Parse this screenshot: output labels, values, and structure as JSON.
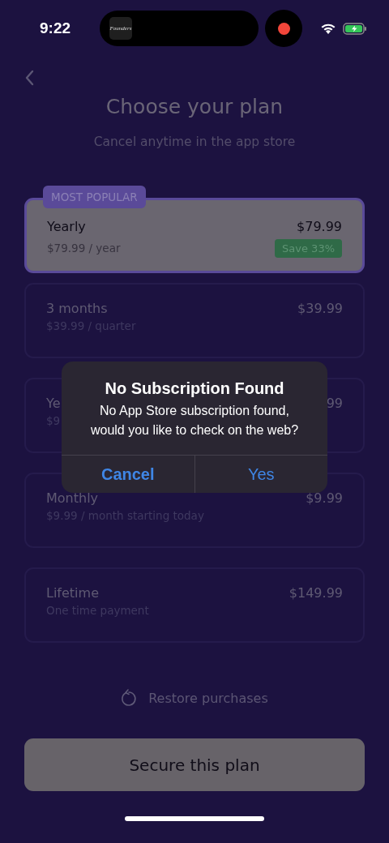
{
  "status_bar": {
    "time": "9:22",
    "island_app_label": "Founders",
    "recording": true
  },
  "header": {
    "title": "Choose your plan",
    "subtitle": "Cancel anytime in the app store"
  },
  "plans": [
    {
      "name": "Yearly",
      "detail": "$79.99 / year",
      "price": "$79.99",
      "badge": "MOST POPULAR",
      "tag": "Save 33%",
      "selected": true
    },
    {
      "name": "3 months",
      "detail": "$39.99 / quarter",
      "price": "$39.99",
      "selected": false
    },
    {
      "name": "Ye",
      "detail": "$9",
      "price": "99",
      "selected": false
    },
    {
      "name": "Monthly",
      "detail": "$9.99 / month starting today",
      "price": "$9.99",
      "selected": false
    },
    {
      "name": "Lifetime",
      "detail": "One time payment",
      "price": "$149.99",
      "selected": false
    }
  ],
  "restore": {
    "label": "Restore purchases"
  },
  "primary_button": {
    "label": "Secure this plan"
  },
  "alert": {
    "title": "No Subscription Found",
    "message": "No App Store subscription found, would you like to check on the web?",
    "buttons": [
      "Cancel",
      "Yes"
    ]
  }
}
